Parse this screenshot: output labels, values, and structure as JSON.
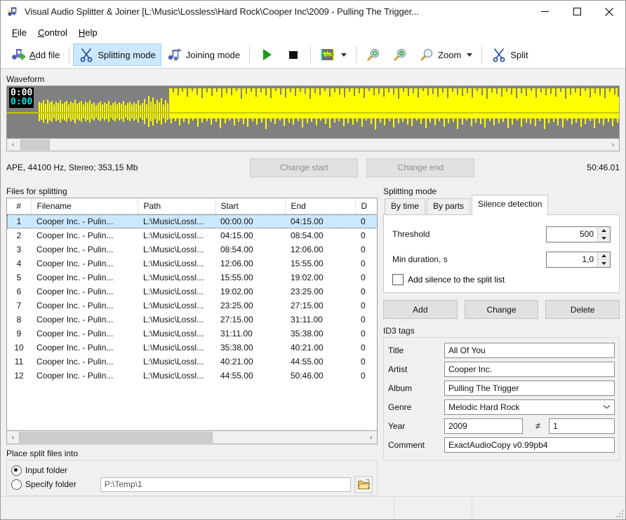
{
  "window": {
    "title": "Visual Audio Splitter & Joiner [L:\\Music\\Lossless\\Hard Rock\\Cooper Inc\\2009 - Pulling The Trigger...",
    "icon": "music-note-app-icon",
    "minimize_label": "—",
    "maximize_label": "□",
    "close_label": "✕"
  },
  "menu": {
    "items": [
      {
        "mnemonic": "F",
        "rest": "ile",
        "name": "file"
      },
      {
        "mnemonic": "C",
        "rest": "ontrol",
        "name": "control"
      },
      {
        "mnemonic": "H",
        "rest": "elp",
        "name": "help"
      }
    ]
  },
  "toolbar": {
    "add_file": "Add file",
    "add_file_mnemonic": "A",
    "add_file_rest": "dd file",
    "splitting_mode": "Splitting mode",
    "joining_mode": "Joining mode",
    "play": "play-icon",
    "stop": "stop-icon",
    "waveform_view": "waveform-view-icon",
    "zoom_in": "zoom-in-icon",
    "zoom_out": "zoom-out-icon",
    "zoom": "Zoom",
    "split": "Split"
  },
  "waveform": {
    "legend": "Waveform",
    "time_top": "0:00",
    "time_bottom": "0:00",
    "scroll_left": "‹",
    "scroll_right": "›"
  },
  "fileinfo": {
    "format": "APE, 44100 Hz, Stereo; 353,15 Mb",
    "change_start": "Change start",
    "change_end": "Change end",
    "total_time": "50:46.01"
  },
  "files_panel": {
    "legend": "Files for splitting",
    "columns": [
      "#",
      "Filename",
      "Path",
      "Start",
      "End",
      "D"
    ],
    "rows": [
      {
        "num": "1",
        "filename": "Cooper Inc. - Pulin...",
        "path": "L:\\Music\\Lossl...",
        "start": "00:00.00",
        "end": "04:15.00",
        "duration": "0",
        "selected": true
      },
      {
        "num": "2",
        "filename": "Cooper Inc. - Pulin...",
        "path": "L:\\Music\\Lossl...",
        "start": "04:15.00",
        "end": "08:54.00",
        "duration": "0",
        "selected": false
      },
      {
        "num": "3",
        "filename": "Cooper Inc. - Pulin...",
        "path": "L:\\Music\\Lossl...",
        "start": "08:54.00",
        "end": "12:06.00",
        "duration": "0",
        "selected": false
      },
      {
        "num": "4",
        "filename": "Cooper Inc. - Pulin...",
        "path": "L:\\Music\\Lossl...",
        "start": "12:06.00",
        "end": "15:55.00",
        "duration": "0",
        "selected": false
      },
      {
        "num": "5",
        "filename": "Cooper Inc. - Pulin...",
        "path": "L:\\Music\\Lossl...",
        "start": "15:55.00",
        "end": "19:02.00",
        "duration": "0",
        "selected": false
      },
      {
        "num": "6",
        "filename": "Cooper Inc. - Pulin...",
        "path": "L:\\Music\\Lossl...",
        "start": "19:02.00",
        "end": "23:25.00",
        "duration": "0",
        "selected": false
      },
      {
        "num": "7",
        "filename": "Cooper Inc. - Pulin...",
        "path": "L:\\Music\\Lossl...",
        "start": "23:25.00",
        "end": "27:15.00",
        "duration": "0",
        "selected": false
      },
      {
        "num": "8",
        "filename": "Cooper Inc. - Pulin...",
        "path": "L:\\Music\\Lossl...",
        "start": "27:15.00",
        "end": "31:11.00",
        "duration": "0",
        "selected": false
      },
      {
        "num": "9",
        "filename": "Cooper Inc. - Pulin...",
        "path": "L:\\Music\\Lossl...",
        "start": "31:11.00",
        "end": "35:38.00",
        "duration": "0",
        "selected": false
      },
      {
        "num": "10",
        "filename": "Cooper Inc. - Pulin...",
        "path": "L:\\Music\\Lossl...",
        "start": "35:38.00",
        "end": "40:21.00",
        "duration": "0",
        "selected": false
      },
      {
        "num": "11",
        "filename": "Cooper Inc. - Pulin...",
        "path": "L:\\Music\\Lossl...",
        "start": "40:21.00",
        "end": "44:55.00",
        "duration": "0",
        "selected": false
      },
      {
        "num": "12",
        "filename": "Cooper Inc. - Pulin...",
        "path": "L:\\Music\\Lossl...",
        "start": "44:55.00",
        "end": "50:46.00",
        "duration": "0",
        "selected": false
      }
    ],
    "scroll_left": "‹",
    "scroll_right": "›"
  },
  "place_panel": {
    "legend": "Place split files into",
    "input_folder": "Input folder",
    "specify_folder": "Specify folder",
    "selected": "input_folder",
    "path_value": "P:\\Temp\\1",
    "browse_icon": "folder-open-icon"
  },
  "splitting_panel": {
    "legend": "Splitting mode",
    "tabs": [
      {
        "label": "By time",
        "active": false
      },
      {
        "label": "By parts",
        "active": false
      },
      {
        "label": "Silence detection",
        "active": true
      }
    ],
    "threshold_label": "Threshold",
    "threshold_value": "500",
    "min_duration_label": "Min duration, s",
    "min_duration_value": "1,0",
    "add_silence_label": "Add silence to the split list",
    "add_silence_checked": false,
    "buttons": {
      "add": "Add",
      "change": "Change",
      "delete": "Delete"
    }
  },
  "id3_panel": {
    "legend": "ID3 tags",
    "title_label": "Title",
    "title_value": "All Of You",
    "artist_label": "Artist",
    "artist_value": "Cooper Inc.",
    "album_label": "Album",
    "album_value": "Pulling The Trigger",
    "genre_label": "Genre",
    "genre_value": "Melodic Hard Rock",
    "year_label": "Year",
    "year_value": "2009",
    "track_symbol": "≠",
    "track_value": "1",
    "comment_label": "Comment",
    "comment_value": "ExactAudioCopy v0.99pb4"
  },
  "colors": {
    "waveform": "#ffff00",
    "waveform_bg": "#808080",
    "selection": "#cce8ff",
    "window_bg": "#f0f0f0"
  }
}
